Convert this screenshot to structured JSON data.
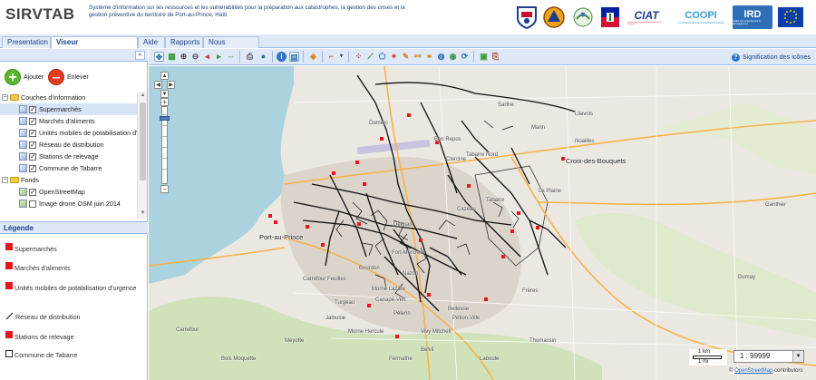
{
  "header": {
    "title": "SIRVTAB",
    "description": "Système d'information sur les ressources et les vulnérabilités pour la préparation aux catastrophes, la gestion des crises et la gestion préventive du territoire de Port-au-Prince, Haïti",
    "logos": {
      "ciat": "CIAT",
      "ciat_sub": "Comité Interministériel d'Aménagement du Territoire",
      "coopi": "COOPI",
      "coopi_sub": "COOPERAZIONE INTERNAZIONALE",
      "ird": "IRD",
      "ird_sub": "Institut de recherche pour le développement"
    }
  },
  "tabs": [
    {
      "label": "Presentation"
    },
    {
      "label": "Viseur cartographique"
    },
    {
      "label": "Aide"
    },
    {
      "label": "Rapports"
    },
    {
      "label": "Nous contacter"
    }
  ],
  "panel": {
    "collapse_icon": "«",
    "add_label": "Ajouter",
    "remove_label": "Enlever"
  },
  "layers": {
    "info_group": "Couches d'information",
    "info_items": [
      {
        "label": "Supermarchés",
        "checked": true
      },
      {
        "label": "Marchés d'aliments",
        "checked": true
      },
      {
        "label": "Unités mobiles de potabilisation d'u",
        "checked": true
      },
      {
        "label": "Réseau de distribution",
        "checked": true
      },
      {
        "label": "Stations de relevage",
        "checked": true
      },
      {
        "label": "Commune de Tabarre",
        "checked": true
      }
    ],
    "base_group": "Fonds",
    "base_items": [
      {
        "label": "OpenStreetMap",
        "checked": true
      },
      {
        "label": "Image drone OSM juin 2014",
        "checked": false
      }
    ]
  },
  "legend": {
    "title": "Légende",
    "items": [
      {
        "label": "Supermarchés",
        "symbol": "red-square"
      },
      {
        "label": "Marchés d'aliments",
        "symbol": "red-square"
      },
      {
        "label": "Unités mobiles de potabilisation d'urgence",
        "symbol": "red-square"
      },
      {
        "label": "Réseau de distribution",
        "symbol": "line"
      },
      {
        "label": "Stations de relevage",
        "symbol": "red-square"
      },
      {
        "label": "Commune de Tabarre",
        "symbol": "outline-square"
      }
    ]
  },
  "toolbar": {
    "help_link": "Signification des icônes"
  },
  "map": {
    "places": {
      "port_au_prince": "Port-au-Prince",
      "croix_des_bouquets": "Croix-des-Bouquets",
      "tabarre": "Tabarre",
      "delmas": "Delmas",
      "petion_ville": "Pétion-Ville",
      "carrefour_feuilles": "Carrefour Feuilles",
      "bon_repos": "Bon Repos",
      "bourdon": "Bourdon",
      "morne_lazare": "Morne Lazare",
      "fort_mercredi": "Fort-Mercredi",
      "pelerin": "Pèlerin",
      "laboule": "Laboule",
      "thomassin": "Thomassin",
      "tabarre_nord": "Tabarre Nord",
      "damien": "Damien",
      "marin": "Marin",
      "lilavois": "Lilavois",
      "sarthe": "Sarthe",
      "clercine": "Clercine",
      "nazon": "Nazon",
      "turgeau": "Turgeau",
      "carrefour": "Carrefour",
      "la_plaine": "La Plaine",
      "bellevue": "Bellevue",
      "cazeau": "Cazeau",
      "canape_vert": "Canapé-Vert",
      "vivy_mitchell": "Vivy Mitchell",
      "morne_hercule": "Morne Hercule",
      "meyotte": "Meyotte",
      "jalousie": "Jalousie",
      "fermathe": "Fermathe",
      "belvil": "Belvil",
      "bois_moquette": "Bois Moquette",
      "frere": "Frères",
      "ganthier": "Ganthier",
      "dumay": "Dumay",
      "noailles": "Noailles"
    },
    "scale": {
      "km_label": "1 km",
      "mi_label": "1 mi",
      "value": "1 : 99999"
    },
    "attribution_link": "OpenStreetMap",
    "attribution_text": "contributors"
  }
}
